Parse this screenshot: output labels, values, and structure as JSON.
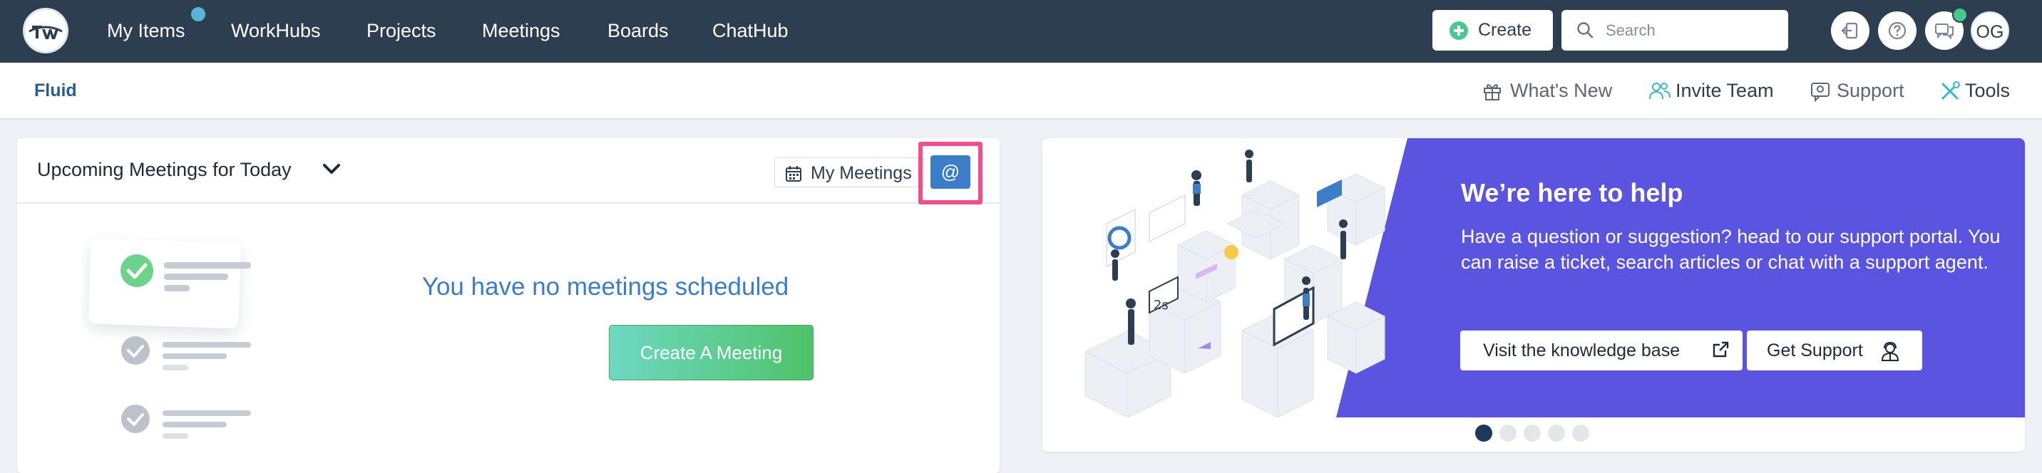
{
  "nav": {
    "items": [
      "My Items",
      "WorkHubs",
      "Projects",
      "Meetings",
      "Boards",
      "ChatHub"
    ],
    "create_label": "Create",
    "search_placeholder": "Search",
    "avatar_initials": "OG"
  },
  "subnav": {
    "workspace": "Fluid",
    "links": [
      "What's New",
      "Invite Team",
      "Support",
      "Tools"
    ]
  },
  "meetings_card": {
    "title": "Upcoming Meetings for Today",
    "filter_label": "My Meetings",
    "at_label": "@",
    "empty_message": "You have no meetings scheduled",
    "create_button": "Create A Meeting"
  },
  "help_card": {
    "title": "We’re here to help",
    "text": "Have a question or suggestion? head to our support portal. You can raise a ticket, search articles or chat with a support agent.",
    "knowledge_button": "Visit the knowledge base",
    "support_button": "Get Support",
    "carousel_count": 5,
    "carousel_active": 1
  },
  "colors": {
    "nav_bg": "#2c3e50",
    "accent_blue": "#3b7dc8",
    "promo_purple": "#5a54e0",
    "highlight_pink": "#ef4f8f",
    "green": "#48c78e"
  }
}
